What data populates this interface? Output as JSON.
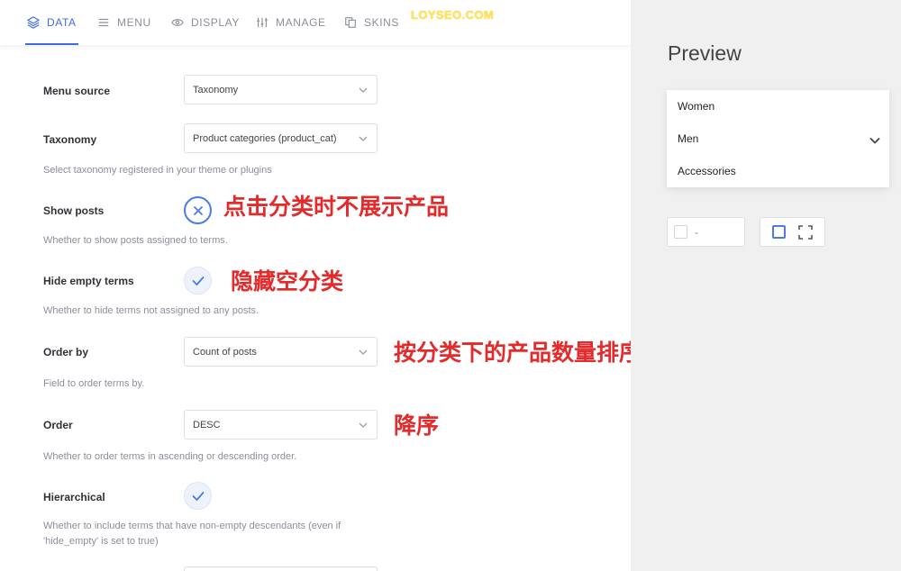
{
  "tabs": [
    {
      "label": "DATA",
      "icon": "layers-icon"
    },
    {
      "label": "MENU",
      "icon": "menu-lines-icon"
    },
    {
      "label": "DISPLAY",
      "icon": "eye-icon"
    },
    {
      "label": "MANAGE",
      "icon": "sliders-icon"
    },
    {
      "label": "SKINS",
      "icon": "copy-icon"
    }
  ],
  "watermark": "LOYSEO.COM",
  "settings": {
    "menu_source": {
      "label": "Menu source",
      "value": "Taxonomy"
    },
    "taxonomy": {
      "label": "Taxonomy",
      "value": "Product categories (product_cat)",
      "help": "Select taxonomy registered in your theme or plugins"
    },
    "show_posts": {
      "label": "Show posts",
      "help": "Whether to show posts assigned to terms.",
      "checked": false
    },
    "hide_empty": {
      "label": "Hide empty terms",
      "help": "Whether to hide terms not assigned to any posts.",
      "checked": true
    },
    "order_by": {
      "label": "Order by",
      "value": "Count of posts",
      "help": "Field to order terms by."
    },
    "order": {
      "label": "Order",
      "value": "DESC",
      "help": "Whether to order terms in ascending or descending order."
    },
    "hierarchical": {
      "label": "Hierarchical",
      "help1": "Whether to include terms that have non-empty descendants (even if",
      "help2": "'hide_empty' is set to true)",
      "checked": true
    }
  },
  "annotations": {
    "show_posts": "点击分类时不展示产品",
    "hide_empty": "隐藏空分类",
    "order_by": "按分类下的产品数量排序",
    "order": "降序"
  },
  "preview": {
    "title": "Preview",
    "menu_items": [
      "Women",
      "Men",
      "Accessories"
    ],
    "control_text": "-"
  },
  "colors": {
    "accent": "#3d6de0",
    "annotation": "#e42a2a",
    "watermark": "#ffe45c"
  }
}
